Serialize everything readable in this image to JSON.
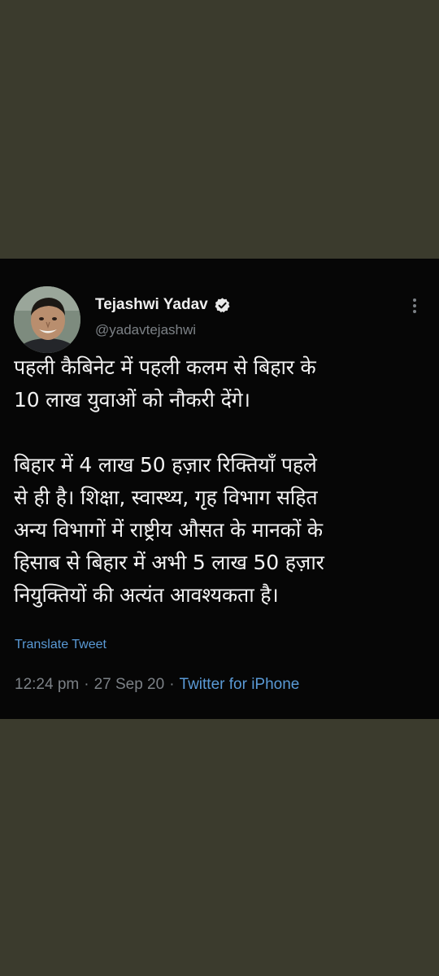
{
  "tweet": {
    "author": {
      "name": "Tejashwi Yadav",
      "handle": "@yadavtejashwi",
      "verified": true
    },
    "text": "पहली कैबिनेट में पहली कलम से बिहार के\n10 लाख युवाओं को नौकरी देंगे।\n\nबिहार में 4 लाख 50 हज़ार रिक्तियाँ पहले\nसे ही है। शिक्षा, स्वास्थ्य, गृह विभाग सहित\nअन्य विभागों में राष्ट्रीय औसत के मानकों के\nहिसाब से बिहार में अभी 5 लाख 50 हज़ार\nनियुक्तियों की अत्यंत आवश्यकता है।",
    "translate_label": "Translate Tweet",
    "time": "12:24 pm",
    "separator": "·",
    "date": "27 Sep 20",
    "source": "Twitter for iPhone"
  },
  "icons": {
    "verified": "verified-badge-icon",
    "more": "more-vertical-icon"
  },
  "colors": {
    "background": "#3b3b2d",
    "card": "#060606",
    "text": "#f1f1f1",
    "muted": "#7c8186",
    "link": "#5a9ad6"
  }
}
